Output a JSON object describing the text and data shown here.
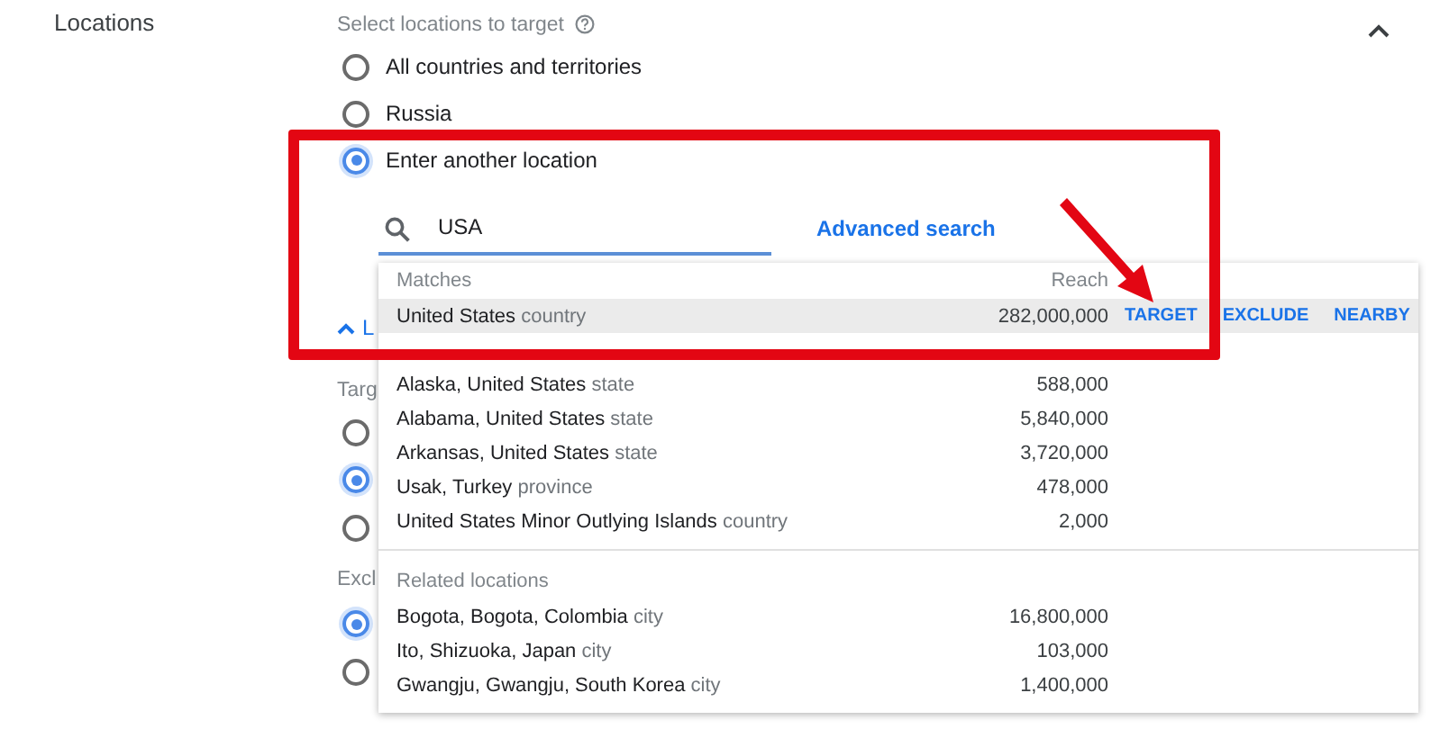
{
  "section": {
    "label": "Locations",
    "expanded": true
  },
  "targeting": {
    "title": "Select locations to target",
    "options": [
      {
        "label": "All countries and territories",
        "selected": false
      },
      {
        "label": "Russia",
        "selected": false
      },
      {
        "label": "Enter another location",
        "selected": true
      }
    ]
  },
  "search": {
    "value": "USA",
    "link": "Advanced search"
  },
  "behind": {
    "toggle": "L",
    "target_heading": "Targ",
    "target_options": [
      {
        "selected": false
      },
      {
        "selected": true
      },
      {
        "selected": false
      }
    ],
    "exclude_heading": "Excl",
    "exclude_options": [
      {
        "selected": true
      },
      {
        "selected": false
      }
    ]
  },
  "dropdown": {
    "groups": [
      {
        "title": "Matches",
        "reach_heading": "Reach",
        "items": [
          {
            "name": "United States",
            "type": "country",
            "reach": "282,000,000",
            "selected": true,
            "actions": [
              "TARGET",
              "EXCLUDE",
              "NEARBY"
            ]
          },
          {
            "name": "Alaska, United States",
            "type": "state",
            "reach": "588,000",
            "selected": false
          },
          {
            "name": "Alabama, United States",
            "type": "state",
            "reach": "5,840,000",
            "selected": false
          },
          {
            "name": "Arkansas, United States",
            "type": "state",
            "reach": "3,720,000",
            "selected": false
          },
          {
            "name": "Usak, Turkey",
            "type": "province",
            "reach": "478,000",
            "selected": false
          },
          {
            "name": "United States Minor Outlying Islands",
            "type": "country",
            "reach": "2,000",
            "selected": false
          }
        ]
      },
      {
        "title": "Related locations",
        "items": [
          {
            "name": "Bogota, Bogota, Colombia",
            "type": "city",
            "reach": "16,800,000",
            "selected": false
          },
          {
            "name": "Ito, Shizuoka, Japan",
            "type": "city",
            "reach": "103,000",
            "selected": false
          },
          {
            "name": "Gwangju, Gwangju, South Korea",
            "type": "city",
            "reach": "1,400,000",
            "selected": false
          }
        ]
      }
    ]
  }
}
